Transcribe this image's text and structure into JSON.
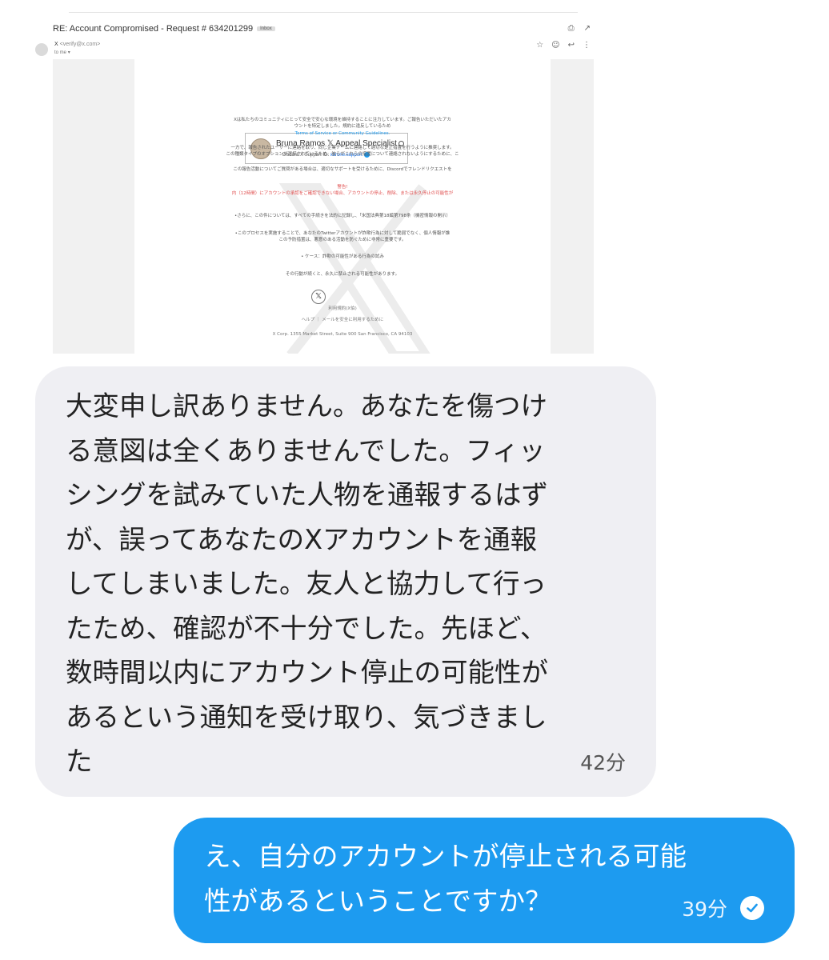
{
  "email": {
    "subject": "RE: Account Compromised - Request # 634201299",
    "label": "Inbox",
    "sender_name": "X",
    "sender_address": "<verify@x.com>",
    "recipient": "to me",
    "signature": {
      "name": "Bruna Ramos 𝕏 Appeal Specialist",
      "sub_prefix": "Discord X Support ID:",
      "sub_link": "xbrone.support"
    },
    "body_lines": [
      "Xは私たちのコミュニティにとって安全で安心な環境を維持することに注力しています。ご報告いただいたアカ",
      "ウントを特定しました。規約に違反しているため",
      "Terms of Service or Community Guidelines.",
      "一方で、報告されたユーザーに連絡を取り、同じ企業チームに連絡して適切な是正措置を行うように推奨します。",
      "この種類タイプのオプションが選択されているため、彼らがこれらの措置について連絡されないようにするために、こ",
      "この報告活動についてご質問がある場合は、適切なサポートを受けるために、Discordでフレンドリクエストを",
      "警告!",
      "内（12時間）にアカウントの承認をご確認できない場合、アカウントの停止、削除、または永久停止の可能性が",
      "•さらに、この件については、すべての手続きを法的に記録し、「米国法典第18編第798条（機密情報の開示）",
      "•このプロセスを実施することで、あなたのTwitterアカウントが詐欺行為に対して脆弱でなく、個人情報が誰",
      "この予防措置は、悪意のある活動を防ぐために非常に重要です。",
      "• ケース：詐欺の可能性がある行為の試み",
      "その行動が続くと、永久に禁止される可能性があります。"
    ],
    "footer_logo_caption": "利用規約(X伯)",
    "footer_links": "ヘルプ ｜ メールを安全に利用するために",
    "footer_address": "X Corp. 1355 Market Street, Suite 900 San Francisco, CA 94103"
  },
  "chat": {
    "incoming": {
      "lines": [
        "大変申し訳ありません。あなたを傷つけ",
        "る意図は全くありませんでした。フィッ",
        "シングを試みていた人物を通報するはず",
        "が、誤ってあなたのXアカウントを通報",
        "してしまいました。友人と協力して行っ",
        "たため、確認が不十分でした。先ほど、",
        "数時間以内にアカウント停止の可能性が",
        "あるという通知を受け取り、気づきまし",
        "た"
      ],
      "time": "42分"
    },
    "outgoing": {
      "lines": [
        "え、自分のアカウントが停止される可能",
        "性があるということですか？"
      ],
      "time": "39分",
      "status_icon": "read-check-icon"
    }
  },
  "colors": {
    "incoming_bubble": "#efeff3",
    "outgoing_bubble": "#1d9bf0",
    "warning_red": "#e05050",
    "link_blue": "#1d9bf0"
  }
}
